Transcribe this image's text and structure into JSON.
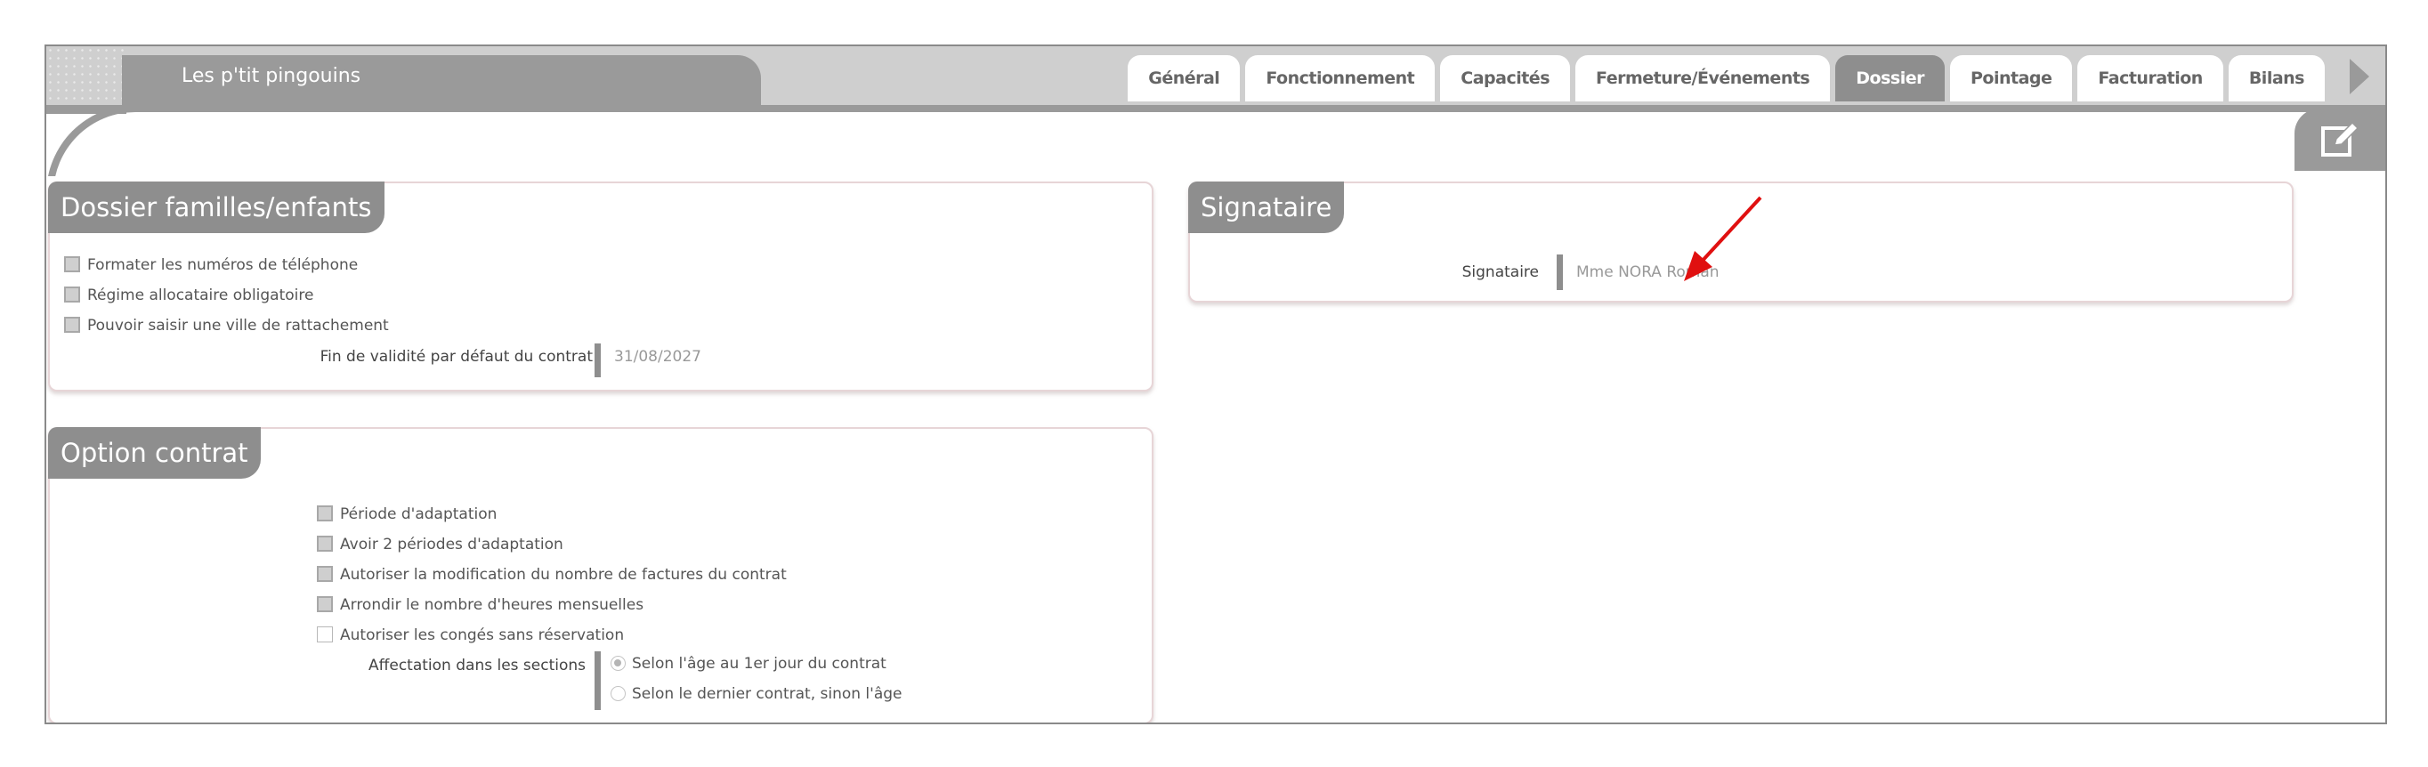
{
  "window": {
    "title": "Les p'tit pingouins"
  },
  "tabs": [
    {
      "label": "Général",
      "active": false
    },
    {
      "label": "Fonctionnement",
      "active": false
    },
    {
      "label": "Capacités",
      "active": false
    },
    {
      "label": "Fermeture/Événements",
      "active": false
    },
    {
      "label": "Dossier",
      "active": true
    },
    {
      "label": "Pointage",
      "active": false
    },
    {
      "label": "Facturation",
      "active": false
    },
    {
      "label": "Bilans",
      "active": false
    }
  ],
  "icons": {
    "tabs_next": "arrow-right-icon",
    "edit": "edit-icon"
  },
  "dossier": {
    "title": "Dossier familles/enfants",
    "options": [
      {
        "label": "Formater les numéros de téléphone",
        "checked": false
      },
      {
        "label": "Régime allocataire obligatoire",
        "checked": false
      },
      {
        "label": "Pouvoir saisir une ville de rattachement",
        "checked": false
      }
    ],
    "validity_label": "Fin de validité par défaut du contrat",
    "validity_value": "31/08/2027"
  },
  "signataire": {
    "title": "Signataire",
    "field_label": "Signataire",
    "field_value": "Mme NORA Roman"
  },
  "contrat": {
    "title": "Option contrat",
    "options": [
      {
        "label": "Période d'adaptation",
        "checked": false
      },
      {
        "label": "Avoir 2 périodes d'adaptation",
        "checked": false
      },
      {
        "label": "Autoriser la modification du nombre de factures du contrat",
        "checked": false
      },
      {
        "label": "Arrondir le nombre d'heures mensuelles",
        "checked": false
      },
      {
        "label": "Autoriser les congés sans réservation",
        "checked": false
      }
    ],
    "affectation_label": "Affectation dans les sections",
    "affectation_options": [
      {
        "label": "Selon l'âge au 1er jour du contrat",
        "selected": true
      },
      {
        "label": "Selon le dernier contrat, sinon l'âge",
        "selected": false
      }
    ]
  },
  "colors": {
    "accent": "#8e8e8e",
    "arrow": "#e01010"
  }
}
